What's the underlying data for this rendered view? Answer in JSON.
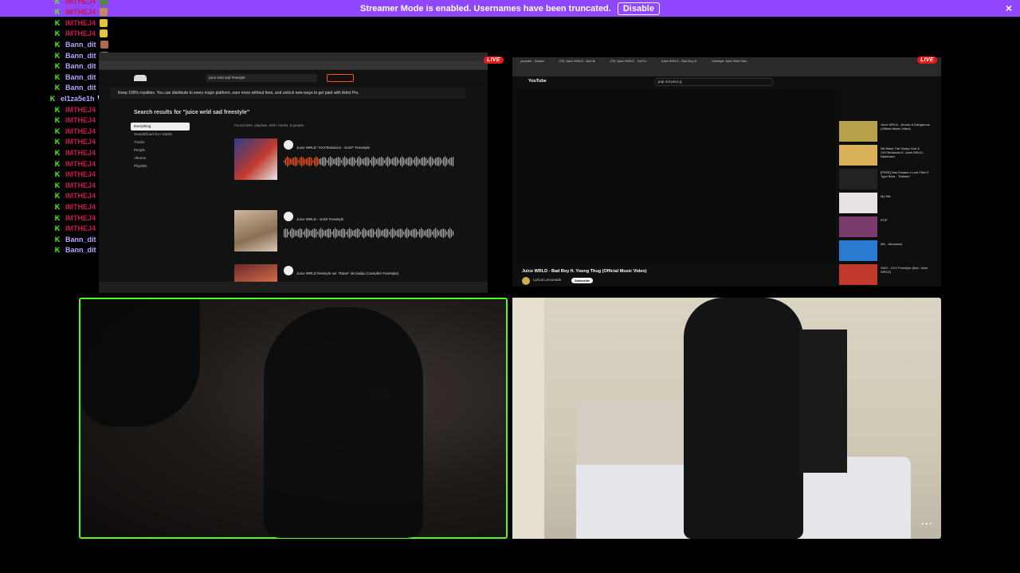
{
  "banner": {
    "text": "Streamer Mode is enabled. Usernames have been truncated.",
    "disable_label": "Disable",
    "close_icon": "×"
  },
  "chat": {
    "badge_glyph": "K",
    "rows": [
      {
        "user": "IMTHEJ4",
        "msg": "",
        "color": "#c7184f",
        "emote": "pepe"
      },
      {
        "user": "IMTHEJ4",
        "msg": "",
        "color": "#c7184f",
        "emote": "eyes"
      },
      {
        "user": "IMTHEJ4",
        "msg": "",
        "color": "#c7184f",
        "emote": "yellow"
      },
      {
        "user": "IMTHEJ4",
        "msg": "",
        "color": "#c7184f",
        "emote": "yellow"
      },
      {
        "user": "Bann_dit",
        "msg": "",
        "color": "#b9a3ff",
        "emote": "face"
      },
      {
        "user": "Bann_dit",
        "msg": "",
        "color": "#b9a3ff",
        "emote": "face"
      },
      {
        "user": "Bann_dit",
        "msg": "",
        "color": "#b9a3ff",
        "emote": "face"
      },
      {
        "user": "Bann_dit",
        "msg": "",
        "color": "#b9a3ff",
        "emote": "face"
      },
      {
        "user": "Bann_dit",
        "msg": "",
        "color": "#b9a3ff",
        "emote": "face"
      },
      {
        "user": "el1za5e1h",
        "msg": "WE GETTING A BOTTLE",
        "color": "#b9a3ff",
        "emote": "none"
      },
      {
        "user": "IMTHEJ4",
        "msg": "",
        "color": "#c7184f",
        "emote": "face"
      },
      {
        "user": "IMTHEJ4",
        "msg": "",
        "color": "#c7184f",
        "emote": "face"
      },
      {
        "user": "IMTHEJ4",
        "msg": "",
        "color": "#c7184f",
        "emote": "face"
      },
      {
        "user": "IMTHEJ4",
        "msg": "",
        "color": "#c7184f",
        "emote": "yellow"
      },
      {
        "user": "IMTHEJ4",
        "msg": "",
        "color": "#c7184f",
        "emote": "yellow"
      },
      {
        "user": "IMTHEJ4",
        "msg": "",
        "color": "#c7184f",
        "emote": "yellow"
      },
      {
        "user": "IMTHEJ4",
        "msg": "",
        "color": "#c7184f",
        "emote": "yellow"
      },
      {
        "user": "IMTHEJ4",
        "msg": "",
        "color": "#c7184f",
        "emote": "pepe"
      },
      {
        "user": "IMTHEJ4",
        "msg": "",
        "color": "#c7184f",
        "emote": "pepe"
      },
      {
        "user": "IMTHEJ4",
        "msg": "",
        "color": "#c7184f",
        "emote": "pepe"
      },
      {
        "user": "IMTHEJ4",
        "msg": "",
        "color": "#c7184f",
        "emote": "pepe"
      },
      {
        "user": "IMTHEJ4",
        "msg": "",
        "color": "#c7184f",
        "emote": "pepe"
      },
      {
        "user": "Bann_dit",
        "msg": "",
        "color": "#b9a3ff",
        "emote": "green"
      },
      {
        "user": "Bann_dit",
        "msg": "",
        "color": "#b9a3ff",
        "emote": "green"
      }
    ]
  },
  "live_label": "LIVE",
  "soundcloud": {
    "notice": "Keep 100% royalties. You can distribute to every major platform, earn more without fees, and unlock new ways to get paid with Artist Pro.",
    "heading": "Search results for \"juice wrld sad freestyle\"",
    "search_value": "juice wrld sad freestyle",
    "sidebar": [
      "Everything",
      "SoundCloud Go+ tracks",
      "Tracks",
      "People",
      "Albums",
      "Playlists"
    ],
    "found_text": "Found 500+ playlists, 500+ tracks, 8 people",
    "tracks": [
      {
        "title": "Juice WRLD \"XXXTentacion - SAD!\" Freestyle"
      },
      {
        "title": "Juice WRLD - SAD! Freestyle"
      },
      {
        "title": "Juice WRLD freestyle sur \"Raise\" de Dadju (Campfire Freestyle)"
      }
    ]
  },
  "youtube": {
    "tabs": [
      "youtube - Search",
      "(75) Juice WRLD - Bad Boy ft. You",
      "(75) Juice WRLD - YouTube",
      "Juice WRLD - Bad Boy ft. Young Thug",
      "freestyle Juice Wrld Sad - Search"
    ],
    "logo": "YouTube",
    "search_value": "pop out pecs g",
    "video_title": "Juice WRLD - Bad Boy ft. Young Thug (Official Music Video)",
    "channel": "Lyrical Lemonade",
    "subscribe_label": "Subscribe",
    "sidebar": [
      {
        "title": "Juice WRLD - Armed & Dangerous (Official Music Video)"
      },
      {
        "title": "Ski Mask The Slump God & XXXTentacion ft. Juice WRLD - Nuketown"
      },
      {
        "title": "[FREE] Nas Exsane x Lost Files 9 Type Beat - \"Daisies\""
      },
      {
        "title": "My Mix"
      },
      {
        "title": "POP"
      },
      {
        "title": "Mix - Mundurwi"
      },
      {
        "title": "SAD! - XXX Freestyle (feat. Juice WRLD)"
      }
    ]
  },
  "cam": {
    "more_icon": "···"
  }
}
